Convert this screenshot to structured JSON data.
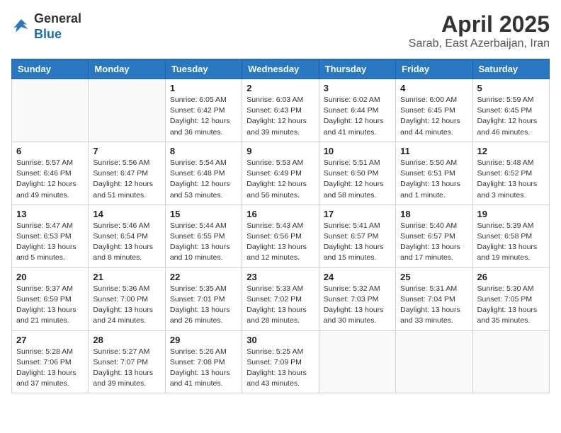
{
  "header": {
    "logo": {
      "general": "General",
      "blue": "Blue"
    },
    "title": "April 2025",
    "subtitle": "Sarab, East Azerbaijan, Iran"
  },
  "weekdays": [
    "Sunday",
    "Monday",
    "Tuesday",
    "Wednesday",
    "Thursday",
    "Friday",
    "Saturday"
  ],
  "weeks": [
    [
      {
        "day": "",
        "info": ""
      },
      {
        "day": "",
        "info": ""
      },
      {
        "day": "1",
        "info": "Sunrise: 6:05 AM\nSunset: 6:42 PM\nDaylight: 12 hours and 36 minutes."
      },
      {
        "day": "2",
        "info": "Sunrise: 6:03 AM\nSunset: 6:43 PM\nDaylight: 12 hours and 39 minutes."
      },
      {
        "day": "3",
        "info": "Sunrise: 6:02 AM\nSunset: 6:44 PM\nDaylight: 12 hours and 41 minutes."
      },
      {
        "day": "4",
        "info": "Sunrise: 6:00 AM\nSunset: 6:45 PM\nDaylight: 12 hours and 44 minutes."
      },
      {
        "day": "5",
        "info": "Sunrise: 5:59 AM\nSunset: 6:45 PM\nDaylight: 12 hours and 46 minutes."
      }
    ],
    [
      {
        "day": "6",
        "info": "Sunrise: 5:57 AM\nSunset: 6:46 PM\nDaylight: 12 hours and 49 minutes."
      },
      {
        "day": "7",
        "info": "Sunrise: 5:56 AM\nSunset: 6:47 PM\nDaylight: 12 hours and 51 minutes."
      },
      {
        "day": "8",
        "info": "Sunrise: 5:54 AM\nSunset: 6:48 PM\nDaylight: 12 hours and 53 minutes."
      },
      {
        "day": "9",
        "info": "Sunrise: 5:53 AM\nSunset: 6:49 PM\nDaylight: 12 hours and 56 minutes."
      },
      {
        "day": "10",
        "info": "Sunrise: 5:51 AM\nSunset: 6:50 PM\nDaylight: 12 hours and 58 minutes."
      },
      {
        "day": "11",
        "info": "Sunrise: 5:50 AM\nSunset: 6:51 PM\nDaylight: 13 hours and 1 minute."
      },
      {
        "day": "12",
        "info": "Sunrise: 5:48 AM\nSunset: 6:52 PM\nDaylight: 13 hours and 3 minutes."
      }
    ],
    [
      {
        "day": "13",
        "info": "Sunrise: 5:47 AM\nSunset: 6:53 PM\nDaylight: 13 hours and 5 minutes."
      },
      {
        "day": "14",
        "info": "Sunrise: 5:46 AM\nSunset: 6:54 PM\nDaylight: 13 hours and 8 minutes."
      },
      {
        "day": "15",
        "info": "Sunrise: 5:44 AM\nSunset: 6:55 PM\nDaylight: 13 hours and 10 minutes."
      },
      {
        "day": "16",
        "info": "Sunrise: 5:43 AM\nSunset: 6:56 PM\nDaylight: 13 hours and 12 minutes."
      },
      {
        "day": "17",
        "info": "Sunrise: 5:41 AM\nSunset: 6:57 PM\nDaylight: 13 hours and 15 minutes."
      },
      {
        "day": "18",
        "info": "Sunrise: 5:40 AM\nSunset: 6:57 PM\nDaylight: 13 hours and 17 minutes."
      },
      {
        "day": "19",
        "info": "Sunrise: 5:39 AM\nSunset: 6:58 PM\nDaylight: 13 hours and 19 minutes."
      }
    ],
    [
      {
        "day": "20",
        "info": "Sunrise: 5:37 AM\nSunset: 6:59 PM\nDaylight: 13 hours and 21 minutes."
      },
      {
        "day": "21",
        "info": "Sunrise: 5:36 AM\nSunset: 7:00 PM\nDaylight: 13 hours and 24 minutes."
      },
      {
        "day": "22",
        "info": "Sunrise: 5:35 AM\nSunset: 7:01 PM\nDaylight: 13 hours and 26 minutes."
      },
      {
        "day": "23",
        "info": "Sunrise: 5:33 AM\nSunset: 7:02 PM\nDaylight: 13 hours and 28 minutes."
      },
      {
        "day": "24",
        "info": "Sunrise: 5:32 AM\nSunset: 7:03 PM\nDaylight: 13 hours and 30 minutes."
      },
      {
        "day": "25",
        "info": "Sunrise: 5:31 AM\nSunset: 7:04 PM\nDaylight: 13 hours and 33 minutes."
      },
      {
        "day": "26",
        "info": "Sunrise: 5:30 AM\nSunset: 7:05 PM\nDaylight: 13 hours and 35 minutes."
      }
    ],
    [
      {
        "day": "27",
        "info": "Sunrise: 5:28 AM\nSunset: 7:06 PM\nDaylight: 13 hours and 37 minutes."
      },
      {
        "day": "28",
        "info": "Sunrise: 5:27 AM\nSunset: 7:07 PM\nDaylight: 13 hours and 39 minutes."
      },
      {
        "day": "29",
        "info": "Sunrise: 5:26 AM\nSunset: 7:08 PM\nDaylight: 13 hours and 41 minutes."
      },
      {
        "day": "30",
        "info": "Sunrise: 5:25 AM\nSunset: 7:09 PM\nDaylight: 13 hours and 43 minutes."
      },
      {
        "day": "",
        "info": ""
      },
      {
        "day": "",
        "info": ""
      },
      {
        "day": "",
        "info": ""
      }
    ]
  ]
}
